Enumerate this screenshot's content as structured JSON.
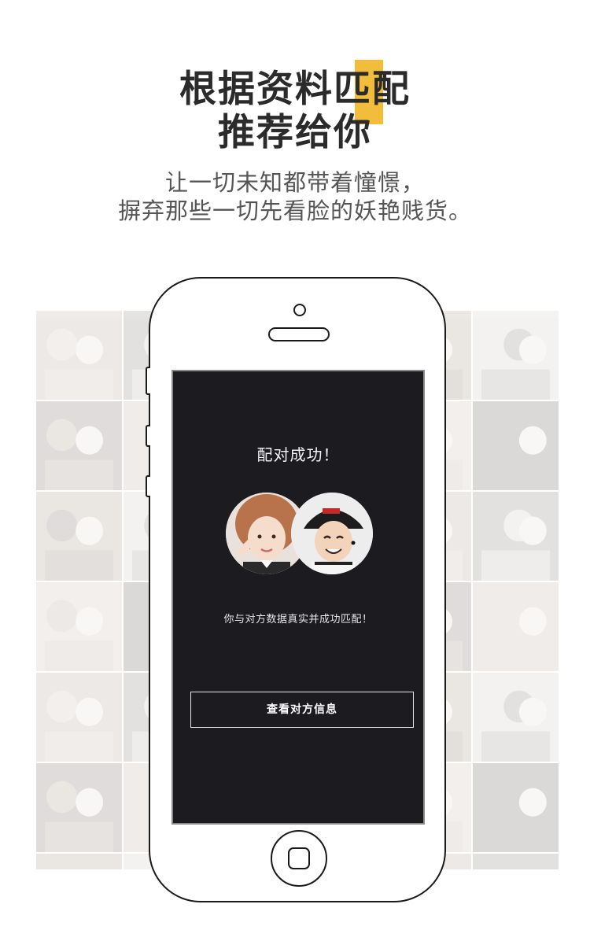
{
  "headline": {
    "line1": "根据资料匹配",
    "line2": "推荐给你",
    "accent_color": "#f2bd3a"
  },
  "subtitle": {
    "line1": "让一切未知都带着憧憬，",
    "line2": "摒弃那些一切先看脸的妖艳贱货。"
  },
  "phone_screen": {
    "title": "配对成功！",
    "description": "你与对方数据真实并成功匹配！",
    "view_button_label": "查看对方信息",
    "background_color": "#1c1b1f"
  },
  "icons": [
    "camera-icon",
    "speaker-icon",
    "home-button-icon"
  ]
}
